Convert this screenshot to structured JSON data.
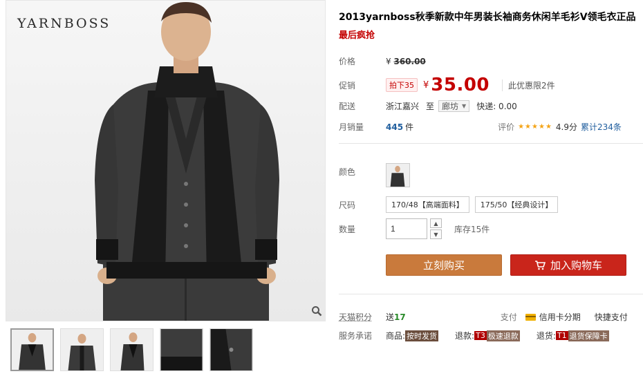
{
  "gallery": {
    "brand": "YARNBOSS",
    "zoom_icon": "magnifier-icon",
    "thumbs": [
      "thumb-1",
      "thumb-2",
      "thumb-3",
      "thumb-4",
      "thumb-5"
    ]
  },
  "product": {
    "title": "2013yarnboss秋季新款中年男装长袖商务休闲羊毛衫V领毛衣正品",
    "subtitle": "最后疯抢"
  },
  "price": {
    "label": "价格",
    "currency": "¥",
    "original": "360.00"
  },
  "promo": {
    "label": "促销",
    "tag": "拍下35",
    "currency": "¥",
    "price": "35.00",
    "limit": "此优惠限2件"
  },
  "delivery": {
    "label": "配送",
    "from": "浙江嘉兴",
    "to_word": "至",
    "dest": "廊坊",
    "express": "快递: 0.00"
  },
  "sales": {
    "label": "月销量",
    "count": "445",
    "unit": "件",
    "rating_label": "评价",
    "stars": "★★★★★",
    "rating": "4.9分",
    "total": "累计234条"
  },
  "options": {
    "color_label": "颜色",
    "size_label": "尺码",
    "sizes": [
      "170/48【高端面料】",
      "175/50【经典设计】"
    ],
    "qty_label": "数量",
    "qty_value": "1",
    "stock": "库存15件"
  },
  "actions": {
    "buy": "立刻购买",
    "cart": "加入购物车"
  },
  "points": {
    "label": "天猫积分",
    "gift_prefix": "送",
    "gift_value": "17",
    "pay_label": "支付",
    "credit": "信用卡分期",
    "quick": "快捷支付"
  },
  "service": {
    "label": "服务承诺",
    "items": [
      {
        "prefix": "商品:",
        "code": "",
        "text": "按时发货"
      },
      {
        "prefix": "退款:",
        "code": "T3",
        "text": "极速退款"
      },
      {
        "prefix": "退货:",
        "code": "T1",
        "text": "退货保障卡"
      }
    ]
  },
  "colors": {
    "accent_red": "#c40000",
    "buy_button": "#c97a3c",
    "cart_button": "#c9251b",
    "link_blue": "#205e9e"
  }
}
